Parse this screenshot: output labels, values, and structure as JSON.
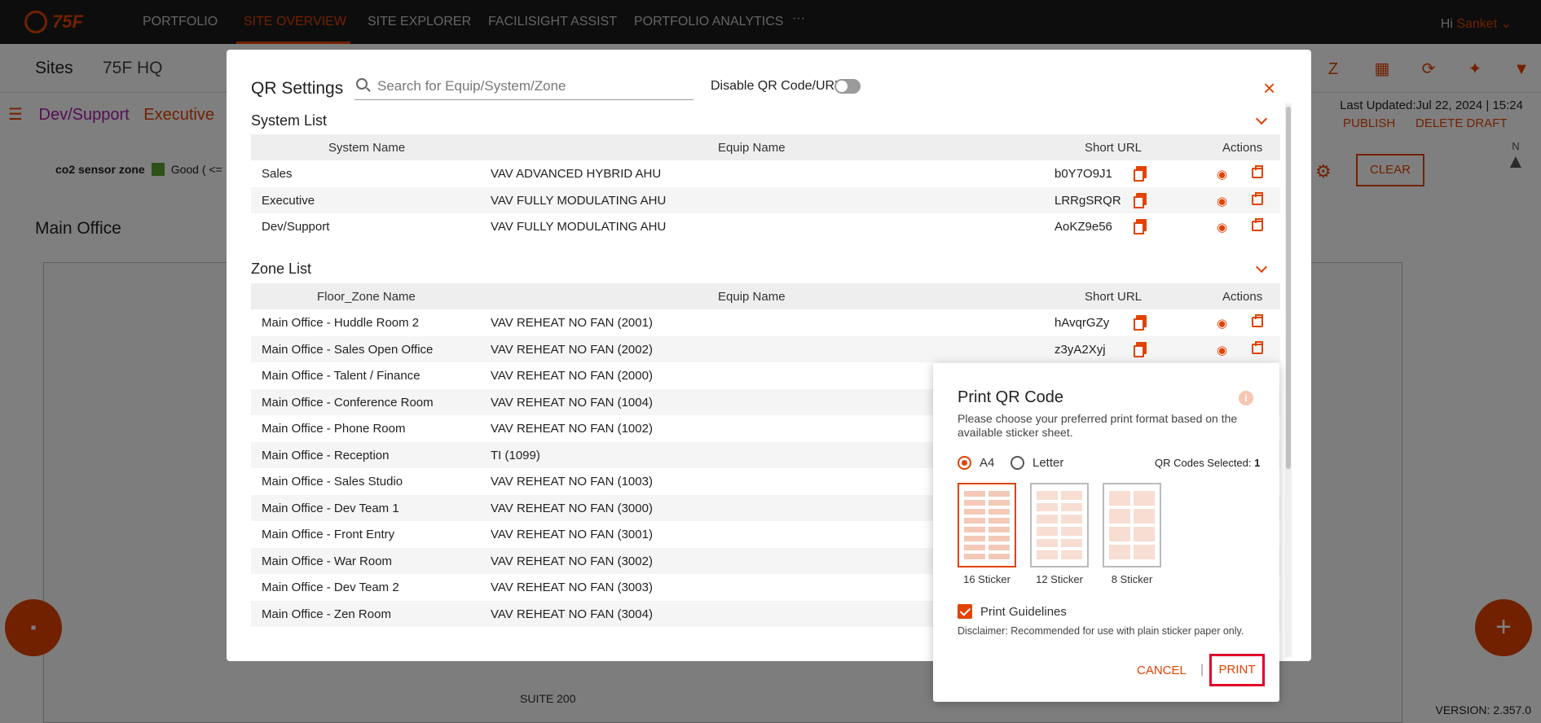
{
  "nav": {
    "logo": "75F",
    "items": [
      "PORTFOLIO",
      "SITE OVERVIEW",
      "SITE EXPLORER",
      "FACILISIGHT ASSIST",
      "PORTFOLIO ANALYTICS",
      "···"
    ],
    "greeting": "Hi",
    "user": "Sanket"
  },
  "subheader": {
    "sites_label": "Sites",
    "site_name": "75F HQ"
  },
  "breadcrumb": {
    "first": "Dev/Support",
    "second": "Executive"
  },
  "status": {
    "last_updated": "Last Updated:Jul 22, 2024 | 15:24",
    "publish": "PUBLISH",
    "delete_draft": "DELETE DRAFT"
  },
  "legend": {
    "label": "co2 sensor zone",
    "good": "Good ( <="
  },
  "clear_label": "CLEAR",
  "compass_label": "N",
  "main_office": "Main Office",
  "suite_label": "SUITE 200",
  "version": "VERSION: 2.357.0",
  "qr_modal": {
    "title": "QR Settings",
    "search_placeholder": "Search for Equip/System/Zone",
    "disable_label": "Disable QR Code/URL",
    "close": "×",
    "system_list": {
      "title": "System List",
      "headers": [
        "System Name",
        "Equip Name",
        "Short URL",
        "Actions"
      ],
      "rows": [
        {
          "name": "Sales",
          "equip": "VAV ADVANCED HYBRID AHU",
          "url": "b0Y7O9J1"
        },
        {
          "name": "Executive",
          "equip": "VAV FULLY MODULATING AHU",
          "url": "LRRgSRQR"
        },
        {
          "name": "Dev/Support",
          "equip": "VAV FULLY MODULATING AHU",
          "url": "AoKZ9e56"
        }
      ]
    },
    "zone_list": {
      "title": "Zone List",
      "headers": [
        "Floor_Zone Name",
        "Equip Name",
        "Short URL",
        "Actions"
      ],
      "rows": [
        {
          "name": "Main Office - Huddle Room 2",
          "equip": "VAV REHEAT NO FAN (2001)",
          "url": "hAvqrGZy"
        },
        {
          "name": "Main Office - Sales Open Office",
          "equip": "VAV REHEAT NO FAN (2002)",
          "url": "z3yA2Xyj"
        },
        {
          "name": "Main Office - Talent / Finance",
          "equip": "VAV REHEAT NO FAN (2000)",
          "url": ""
        },
        {
          "name": "Main Office - Conference Room",
          "equip": "VAV REHEAT NO FAN (1004)",
          "url": ""
        },
        {
          "name": "Main Office - Phone Room",
          "equip": "VAV REHEAT NO FAN (1002)",
          "url": ""
        },
        {
          "name": "Main Office - Reception",
          "equip": "TI (1099)",
          "url": ""
        },
        {
          "name": "Main Office - Sales Studio",
          "equip": "VAV REHEAT NO FAN (1003)",
          "url": ""
        },
        {
          "name": "Main Office - Dev Team 1",
          "equip": "VAV REHEAT NO FAN (3000)",
          "url": ""
        },
        {
          "name": "Main Office - Front Entry",
          "equip": "VAV REHEAT NO FAN (3001)",
          "url": ""
        },
        {
          "name": "Main Office - War Room",
          "equip": "VAV REHEAT NO FAN (3002)",
          "url": ""
        },
        {
          "name": "Main Office - Dev Team 2",
          "equip": "VAV REHEAT NO FAN (3003)",
          "url": ""
        },
        {
          "name": "Main Office - Zen Room",
          "equip": "VAV REHEAT NO FAN (3004)",
          "url": ""
        }
      ]
    }
  },
  "print_dialog": {
    "title": "Print QR Code",
    "description": "Please choose your preferred print format based on the available sticker sheet.",
    "options": [
      "A4",
      "Letter"
    ],
    "selected_option": "A4",
    "qr_selected_label": "QR Codes Selected:",
    "qr_selected_count": "1",
    "sheets": [
      "16 Sticker",
      "12 Sticker",
      "8 Sticker"
    ],
    "selected_sheet": "16 Sticker",
    "guidelines_label": "Print Guidelines",
    "disclaimer": "Disclaimer: Recommended for use with plain sticker paper only.",
    "cancel": "CANCEL",
    "separator": "|",
    "print": "PRINT"
  },
  "colors": {
    "accent": "#e24301",
    "nav_bg": "#1a1a1a",
    "highlight_border": "#e0002b"
  },
  "icons": [
    "search-icon",
    "close-icon",
    "chevron-down-icon",
    "copy-icon",
    "eye-icon",
    "printer-icon",
    "info-icon",
    "chat-icon",
    "plus-icon"
  ]
}
